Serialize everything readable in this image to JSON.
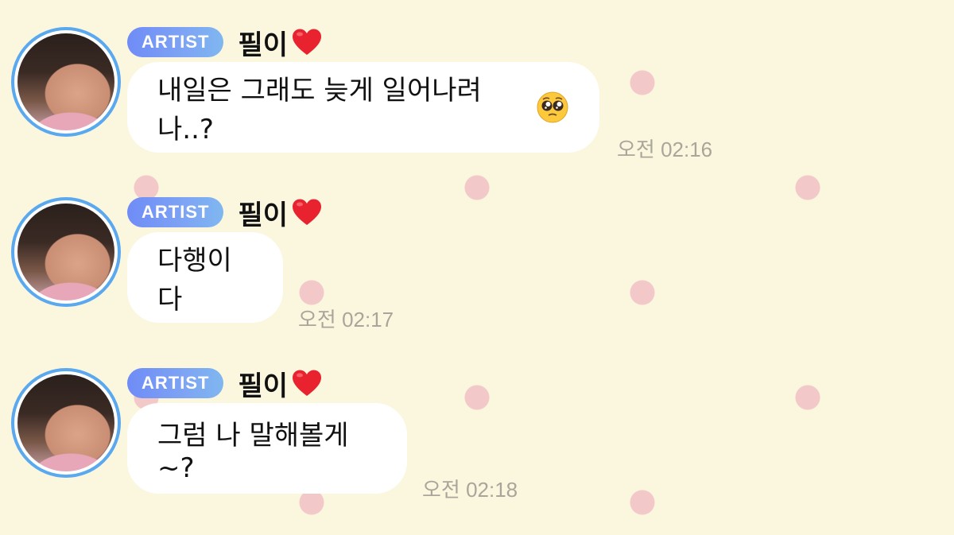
{
  "messages": [
    {
      "badge": "ARTIST",
      "name": "필이",
      "text": "내일은 그래도 늦게 일어나려나..?",
      "has_emoji": true,
      "time": "오전 02:16"
    },
    {
      "badge": "ARTIST",
      "name": "필이",
      "text": "다행이다",
      "has_emoji": false,
      "time": "오전 02:17"
    },
    {
      "badge": "ARTIST",
      "name": "필이",
      "text": "그럼 나 말해볼게~?",
      "has_emoji": false,
      "time": "오전 02:18"
    }
  ],
  "icons": {
    "name_suffix": "red-heart-icon",
    "message_emoji": "pleading-face-icon"
  },
  "colors": {
    "background": "#fbf7df",
    "polka_dot": "#f3c8c8",
    "bubble": "#ffffff",
    "badge_gradient_start": "#6f8cf6",
    "badge_gradient_end": "#7fb7f0",
    "avatar_ring": "#5aa8ee",
    "timestamp": "#a9a59a"
  }
}
